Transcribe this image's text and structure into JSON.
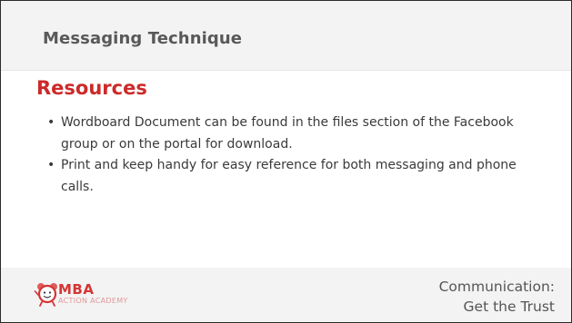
{
  "header": {
    "title": "Messaging Technique"
  },
  "section": {
    "title": "Resources"
  },
  "bullets": [
    "Wordboard Document can be found in the files section of the Facebook group or on the portal for download.",
    "Print and keep handy for easy reference for both messaging and phone calls."
  ],
  "footer": {
    "logo": {
      "primary": "MBA",
      "secondary": "ACTION ACADEMY",
      "icon": "alarm-clock-mascot-icon"
    },
    "caption_line1": "Communication:",
    "caption_line2": "Get the Trust"
  },
  "colors": {
    "band": "#f3f3f3",
    "section_title": "#cc2a2a",
    "logo_red": "#d43535"
  }
}
